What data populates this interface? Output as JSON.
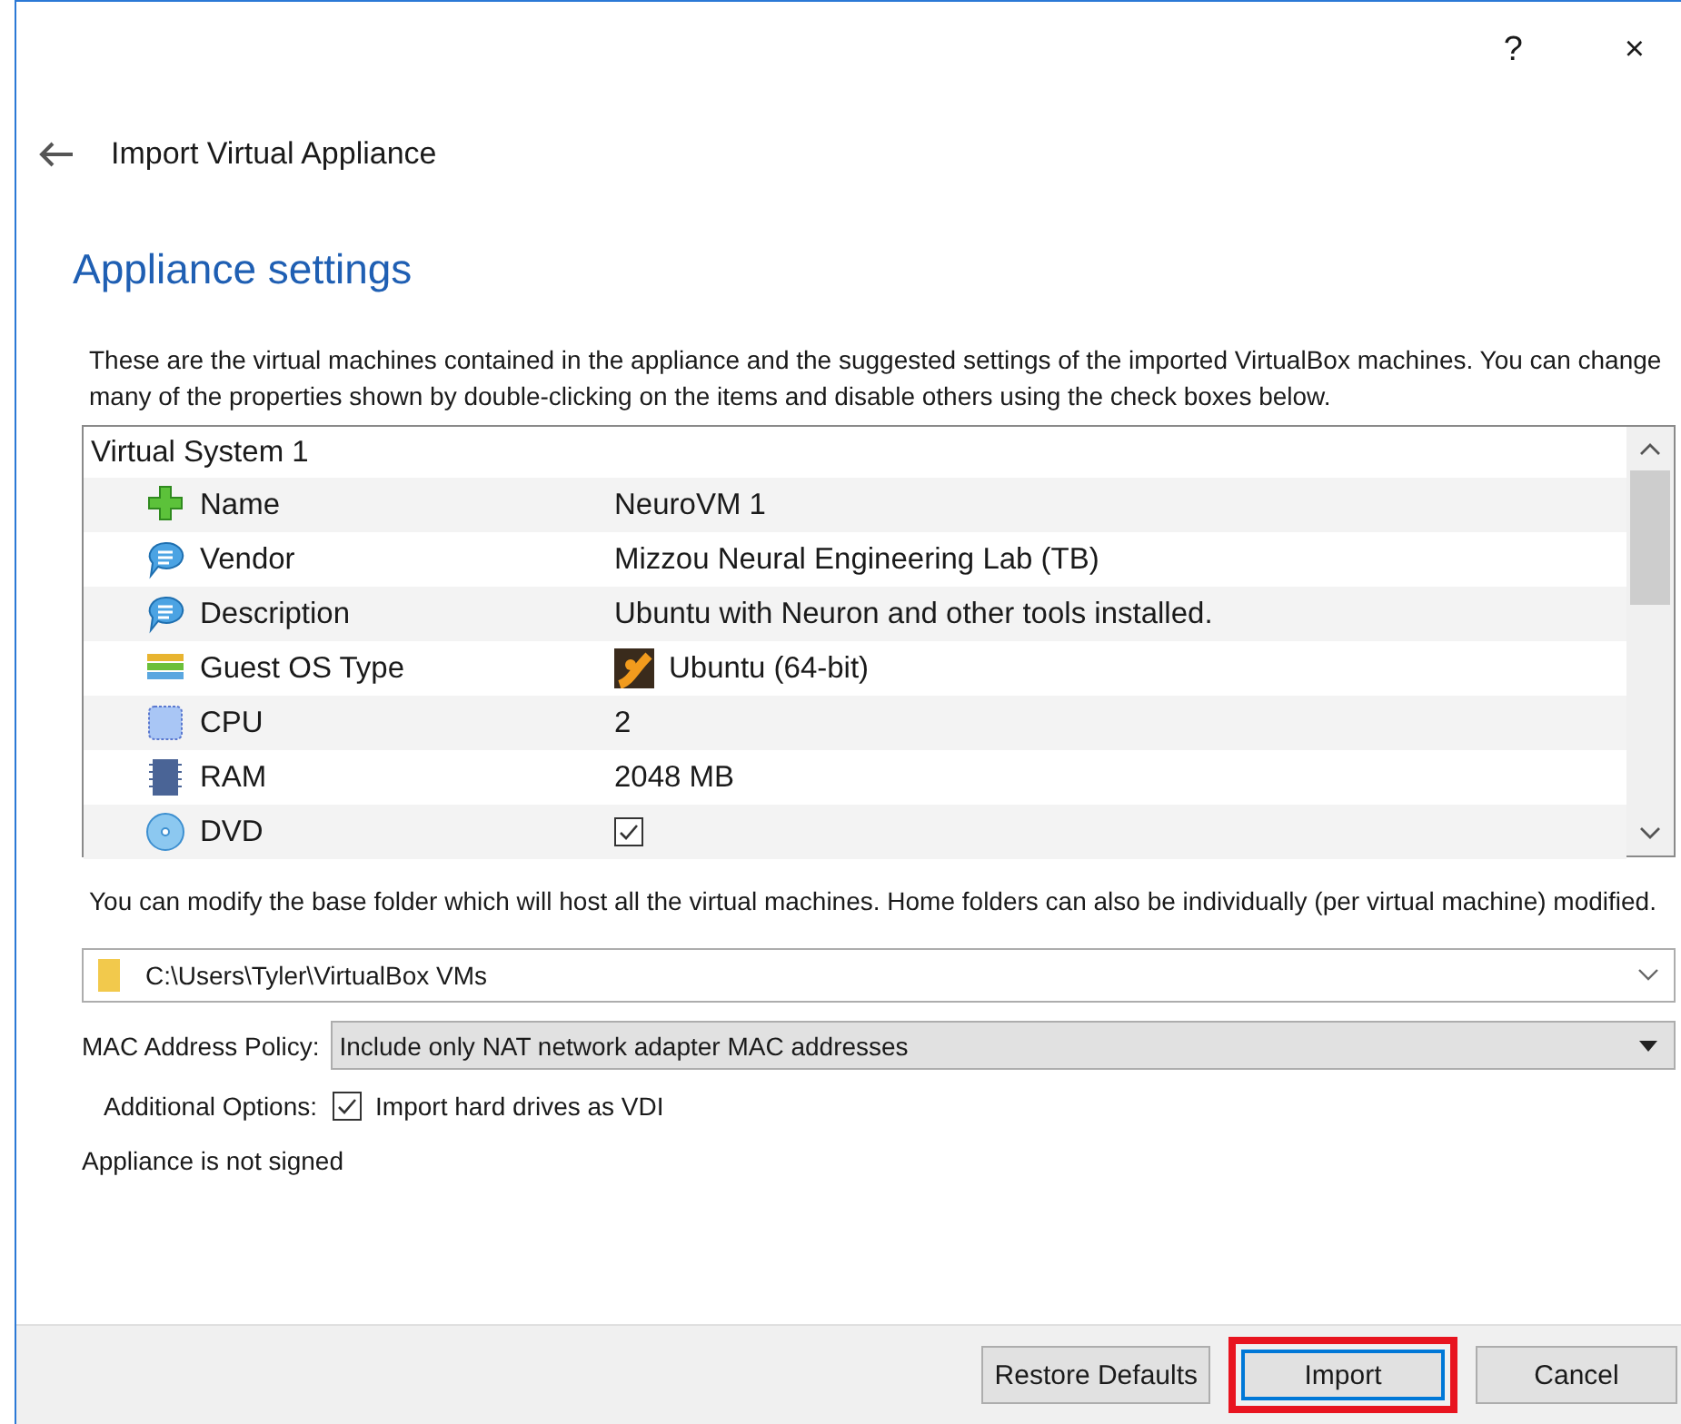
{
  "window": {
    "help": "?",
    "close": "×",
    "title": "Import Virtual Appliance"
  },
  "heading": "Appliance settings",
  "intro": "These are the virtual machines contained in the appliance and the suggested settings of the imported VirtualBox machines. You can change many of the properties shown by double-clicking on the items and disable others using the check boxes below.",
  "tree": {
    "group": "Virtual System 1",
    "rows": [
      {
        "kind": "text",
        "label": "Name",
        "value": "NeuroVM 1"
      },
      {
        "kind": "text",
        "label": "Vendor",
        "value": "Mizzou Neural Engineering Lab (TB)"
      },
      {
        "kind": "text",
        "label": "Description",
        "value": "Ubuntu with Neuron and other tools installed."
      },
      {
        "kind": "os",
        "label": "Guest OS Type",
        "value": "Ubuntu (64-bit)"
      },
      {
        "kind": "text",
        "label": "CPU",
        "value": "2"
      },
      {
        "kind": "text",
        "label": "RAM",
        "value": "2048 MB"
      },
      {
        "kind": "checkbox",
        "label": "DVD",
        "checked": true
      }
    ]
  },
  "folder_note": "You can modify the base folder which will host all the virtual machines. Home folders can also be individually (per virtual machine) modified.",
  "folder": {
    "value": "C:\\Users\\Tyler\\VirtualBox VMs"
  },
  "mac_policy": {
    "label": "MAC Address Policy:",
    "value": "Include only NAT network adapter MAC addresses"
  },
  "additional_options": {
    "label": "Additional Options:",
    "option": "Import hard drives as VDI",
    "checked": true
  },
  "signature": "Appliance is not signed",
  "buttons": [
    {
      "label": "Restore Defaults",
      "highlighted": false,
      "default": false
    },
    {
      "label": "Import",
      "highlighted": true,
      "default": true
    },
    {
      "label": "Cancel",
      "highlighted": false,
      "default": false
    }
  ]
}
